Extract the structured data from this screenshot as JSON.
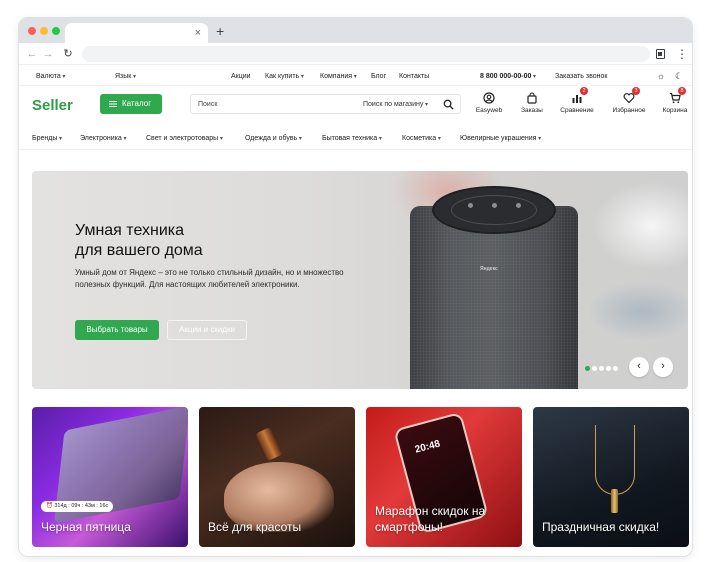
{
  "browser": {
    "tab_close": "×",
    "new_tab": "+"
  },
  "topbar": {
    "currency": "Валюта",
    "language": "Язык",
    "links": [
      "Акции",
      "Как купить",
      "Компания",
      "Блог",
      "Контакты"
    ],
    "phone": "8 800 000-00-00",
    "callback": "Заказать звонок"
  },
  "header": {
    "logo": "Seller",
    "catalog_label": "Каталог",
    "search_placeholder": "Поиск",
    "search_scope": "Поиск по магазину",
    "icons": [
      {
        "label": "Easyweb",
        "icon": "user-icon"
      },
      {
        "label": "Заказы",
        "icon": "bag-icon"
      },
      {
        "label": "Сравнение",
        "icon": "chart-icon",
        "badge": "2"
      },
      {
        "label": "Избранное",
        "icon": "heart-icon",
        "badge": "3"
      },
      {
        "label": "Корзина",
        "icon": "cart-icon",
        "badge": "8"
      }
    ]
  },
  "categories": [
    "Бренды",
    "Электроника",
    "Свет и электротовары",
    "Одежда и обувь",
    "Бытовая техника",
    "Косметика",
    "Ювелирные украшения"
  ],
  "hero": {
    "title": "Умная техника\nдля вашего дома",
    "text": "Умный дом от Яндекс – это не только стильный дизайн, но и множество полезных функций. Для настоящих любителей электроники.",
    "primary_button": "Выбрать товары",
    "secondary_button": "Акции и скидки",
    "slide_count": 5,
    "active_slide": 1,
    "prev_arrow": "‹",
    "next_arrow": "›"
  },
  "cards": [
    {
      "title": "Черная пятница",
      "timer": "⏰ 314д : 09ч : 43м : 16с"
    },
    {
      "title": "Всё для красоты"
    },
    {
      "title": "Марафон скидок на смартфоны!",
      "phone_time": "20:48"
    },
    {
      "title": "Праздничная скидка!"
    }
  ],
  "colors": {
    "brand_green": "#2fa84f",
    "logo_green": "#2f9e44",
    "badge_red": "#e03131"
  }
}
